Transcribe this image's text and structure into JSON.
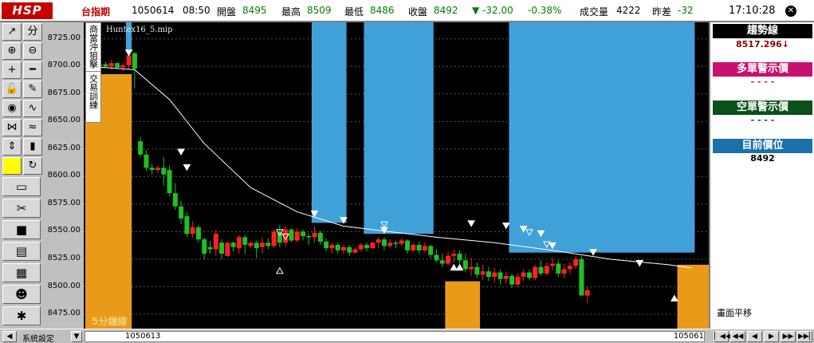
{
  "header": {
    "logo": "HSP",
    "symbol": "台指期",
    "date": "1050614",
    "time": "08:50",
    "open_label": "開盤",
    "open": "8495",
    "high_label": "最高",
    "high": "8509",
    "low_label": "最低",
    "low": "8486",
    "close_label": "收盤",
    "close": "8492",
    "change": "▼ -32.00",
    "change_pct": "-0.38%",
    "volume_label": "成交量",
    "volume": "4222",
    "diff_label": "昨差",
    "diff": "-32",
    "clock": "17:10:28",
    "close_icon": "x-icon"
  },
  "toolbar": {
    "buttons": [
      {
        "icon": "trend-line-icon",
        "glyph": "↗"
      },
      {
        "icon": "split-icon",
        "glyph": "分"
      },
      {
        "icon": "zoom-in-icon",
        "glyph": "⊕"
      },
      {
        "icon": "zoom-out-icon",
        "glyph": "⊖"
      },
      {
        "icon": "crosshair-icon",
        "glyph": "+"
      },
      {
        "icon": "hline-icon",
        "glyph": "━"
      },
      {
        "icon": "lock-icon",
        "glyph": "🔓"
      },
      {
        "icon": "pencil-icon",
        "glyph": "✎"
      },
      {
        "icon": "dial-icon",
        "glyph": "◉"
      },
      {
        "icon": "wave-icon",
        "glyph": "∿"
      },
      {
        "icon": "pattern-icon",
        "glyph": "⋈"
      },
      {
        "icon": "cross-wave-icon",
        "glyph": "≈"
      },
      {
        "icon": "updown-icon",
        "glyph": "⇕"
      },
      {
        "icon": "candle-icon",
        "glyph": "▮"
      },
      {
        "icon": "color-swatch-icon",
        "glyph": ""
      },
      {
        "icon": "refresh-icon",
        "glyph": "↻"
      }
    ],
    "wide_buttons": [
      {
        "icon": "folder-icon",
        "glyph": "▭"
      },
      {
        "icon": "scissors-icon",
        "glyph": "✂"
      },
      {
        "icon": "stop-icon",
        "glyph": "■"
      },
      {
        "icon": "report-icon",
        "glyph": "▤"
      },
      {
        "icon": "grid-icon",
        "glyph": "▦"
      },
      {
        "icon": "people-icon",
        "glyph": "☻"
      },
      {
        "icon": "burst-icon",
        "glyph": "✱"
      }
    ]
  },
  "overlay": {
    "side_label_top": "商當沖狙擊",
    "side_label_bottom": "交易訓練",
    "file": "Huntex16_5.mip",
    "period": "5分鐘線"
  },
  "panel": {
    "trend_title": "趨勢線",
    "trend_value": "8517.296↓",
    "long_title": "多單警示價",
    "long_value": "- - - -",
    "short_title": "空單警示價",
    "short_value": "- - - -",
    "pos_title": "目前價位",
    "pos_value": "8492",
    "pan": "畫面平移",
    "colors": {
      "trend": "#000000",
      "long": "#c8106e",
      "short": "#0a5018",
      "pos": "#1a70a8"
    }
  },
  "bottom": {
    "sys": "系統設定",
    "date_start": "1050613",
    "date_end": "105061",
    "nav": [
      "▏◀◀",
      "◀◀",
      "◀",
      "▶",
      "▶▶",
      "▶▶▏"
    ]
  },
  "chart_data": {
    "type": "candlestick",
    "y_ticks": [
      "8725.00",
      "8700.00",
      "8675.00",
      "8650.00",
      "8625.00",
      "8600.00",
      "8575.00",
      "8550.00",
      "8525.00",
      "8500.00",
      "8475.00"
    ],
    "ylim": [
      8462,
      8740
    ],
    "n_bars": 104,
    "blue_zones": [
      [
        7,
        7
      ],
      [
        39,
        44
      ],
      [
        48,
        59
      ],
      [
        73,
        104
      ]
    ],
    "orange_zones": [
      [
        0,
        7
      ],
      [
        62,
        67
      ],
      [
        102,
        107
      ]
    ],
    "blue_color": "#40a0d8",
    "orange_color": "#e89a18",
    "candles": [
      [
        8700,
        8704,
        8697,
        8701
      ],
      [
        8701,
        8703,
        8699,
        8700
      ],
      [
        8700,
        8705,
        8698,
        8702
      ],
      [
        8702,
        8704,
        8699,
        8700
      ],
      [
        8700,
        8706,
        8698,
        8703
      ],
      [
        8703,
        8704,
        8698,
        8699
      ],
      [
        8699,
        8703,
        8696,
        8701
      ],
      [
        8701,
        8712,
        8698,
        8710
      ],
      [
        8712,
        8713,
        8680,
        8698
      ],
      [
        8632,
        8636,
        8618,
        8620
      ],
      [
        8620,
        8624,
        8605,
        8608
      ],
      [
        8608,
        8612,
        8602,
        8606
      ],
      [
        8606,
        8610,
        8603,
        8608
      ],
      [
        8608,
        8618,
        8592,
        8602
      ],
      [
        8606,
        8610,
        8582,
        8585
      ],
      [
        8585,
        8594,
        8570,
        8573
      ],
      [
        8573,
        8578,
        8557,
        8562
      ],
      [
        8564,
        8568,
        8545,
        8548
      ],
      [
        8548,
        8560,
        8544,
        8554
      ],
      [
        8554,
        8556,
        8540,
        8543
      ],
      [
        8543,
        8545,
        8525,
        8530
      ],
      [
        8536,
        8542,
        8530,
        8534
      ],
      [
        8534,
        8552,
        8528,
        8548
      ],
      [
        8540,
        8543,
        8525,
        8530
      ],
      [
        8528,
        8541,
        8527,
        8540
      ],
      [
        8540,
        8541,
        8532,
        8536
      ],
      [
        8535,
        8547,
        8530,
        8545
      ],
      [
        8545,
        8547,
        8530,
        8538
      ],
      [
        8537,
        8541,
        8535,
        8540
      ],
      [
        8540,
        8542,
        8526,
        8535
      ],
      [
        8536,
        8545,
        8530,
        8540
      ],
      [
        8540,
        8544,
        8534,
        8537
      ],
      [
        8537,
        8552,
        8535,
        8550
      ],
      [
        8550,
        8556,
        8536,
        8540
      ],
      [
        8540,
        8555,
        8536,
        8552
      ],
      [
        8552,
        8553,
        8540,
        8542
      ],
      [
        8542,
        8553,
        8540,
        8550
      ],
      [
        8550,
        8552,
        8542,
        8546
      ],
      [
        8546,
        8548,
        8538,
        8545
      ],
      [
        8545,
        8555,
        8540,
        8549
      ],
      [
        8549,
        8551,
        8538,
        8541
      ],
      [
        8541,
        8544,
        8532,
        8535
      ],
      [
        8535,
        8540,
        8530,
        8538
      ],
      [
        8538,
        8540,
        8530,
        8533
      ],
      [
        8533,
        8538,
        8530,
        8536
      ],
      [
        8536,
        8538,
        8528,
        8531
      ],
      [
        8531,
        8536,
        8530,
        8534
      ],
      [
        8534,
        8540,
        8532,
        8538
      ],
      [
        8538,
        8540,
        8532,
        8535
      ],
      [
        8535,
        8541,
        8534,
        8540
      ],
      [
        8540,
        8545,
        8535,
        8543
      ],
      [
        8543,
        8545,
        8533,
        8537
      ],
      [
        8537,
        8543,
        8535,
        8540
      ],
      [
        8540,
        8542,
        8535,
        8539
      ],
      [
        8539,
        8544,
        8537,
        8542
      ],
      [
        8542,
        8543,
        8530,
        8533
      ],
      [
        8533,
        8540,
        8531,
        8538
      ],
      [
        8538,
        8541,
        8530,
        8533
      ],
      [
        8533,
        8540,
        8531,
        8537
      ],
      [
        8537,
        8538,
        8526,
        8529
      ],
      [
        8529,
        8534,
        8522,
        8524
      ],
      [
        8524,
        8530,
        8518,
        8521
      ],
      [
        8521,
        8532,
        8519,
        8528
      ],
      [
        8528,
        8534,
        8522,
        8530
      ],
      [
        8530,
        8533,
        8521,
        8524
      ],
      [
        8524,
        8530,
        8513,
        8516
      ],
      [
        8516,
        8526,
        8510,
        8518
      ],
      [
        8518,
        8522,
        8508,
        8511
      ],
      [
        8511,
        8520,
        8506,
        8514
      ],
      [
        8514,
        8518,
        8505,
        8509
      ],
      [
        8509,
        8517,
        8504,
        8513
      ],
      [
        8513,
        8516,
        8502,
        8507
      ],
      [
        8507,
        8514,
        8503,
        8510
      ],
      [
        8510,
        8512,
        8499,
        8502
      ],
      [
        8502,
        8512,
        8500,
        8509
      ],
      [
        8509,
        8516,
        8505,
        8513
      ],
      [
        8513,
        8516,
        8506,
        8508
      ],
      [
        8508,
        8520,
        8506,
        8518
      ],
      [
        8518,
        8524,
        8510,
        8512
      ],
      [
        8512,
        8522,
        8510,
        8519
      ],
      [
        8519,
        8526,
        8515,
        8521
      ],
      [
        8521,
        8524,
        8509,
        8512
      ],
      [
        8512,
        8521,
        8508,
        8516
      ],
      [
        8516,
        8522,
        8512,
        8519
      ],
      [
        8519,
        8528,
        8516,
        8525
      ],
      [
        8525,
        8528,
        8512,
        8492
      ],
      [
        8492,
        8500,
        8485,
        8497
      ]
    ],
    "trend_line": [
      [
        0,
        8700
      ],
      [
        8,
        8697
      ],
      [
        14,
        8670
      ],
      [
        20,
        8630
      ],
      [
        28,
        8590
      ],
      [
        36,
        8568
      ],
      [
        44,
        8555
      ],
      [
        52,
        8550
      ],
      [
        60,
        8545
      ],
      [
        70,
        8540
      ],
      [
        80,
        8533
      ],
      [
        90,
        8525
      ],
      [
        100,
        8520
      ],
      [
        104,
        8517
      ]
    ],
    "markers_down": [
      [
        7,
        8712
      ],
      [
        16,
        8622
      ],
      [
        17,
        8608
      ],
      [
        39,
        8566
      ],
      [
        44,
        8560
      ],
      [
        51,
        8551
      ],
      [
        66,
        8557
      ],
      [
        72,
        8555
      ],
      [
        75,
        8552
      ],
      [
        78,
        8548
      ],
      [
        80,
        8537
      ],
      [
        87,
        8531
      ],
      [
        95,
        8521
      ]
    ],
    "markers_down_hollow": [
      [
        33,
        8549
      ],
      [
        34,
        8545
      ],
      [
        51,
        8556
      ],
      [
        76,
        8549
      ],
      [
        79,
        8538
      ]
    ],
    "markers_up_hollow": [
      [
        33,
        8515
      ]
    ],
    "markers_up": [
      [
        63,
        8518
      ],
      [
        64,
        8518
      ],
      [
        101,
        8490
      ]
    ]
  }
}
